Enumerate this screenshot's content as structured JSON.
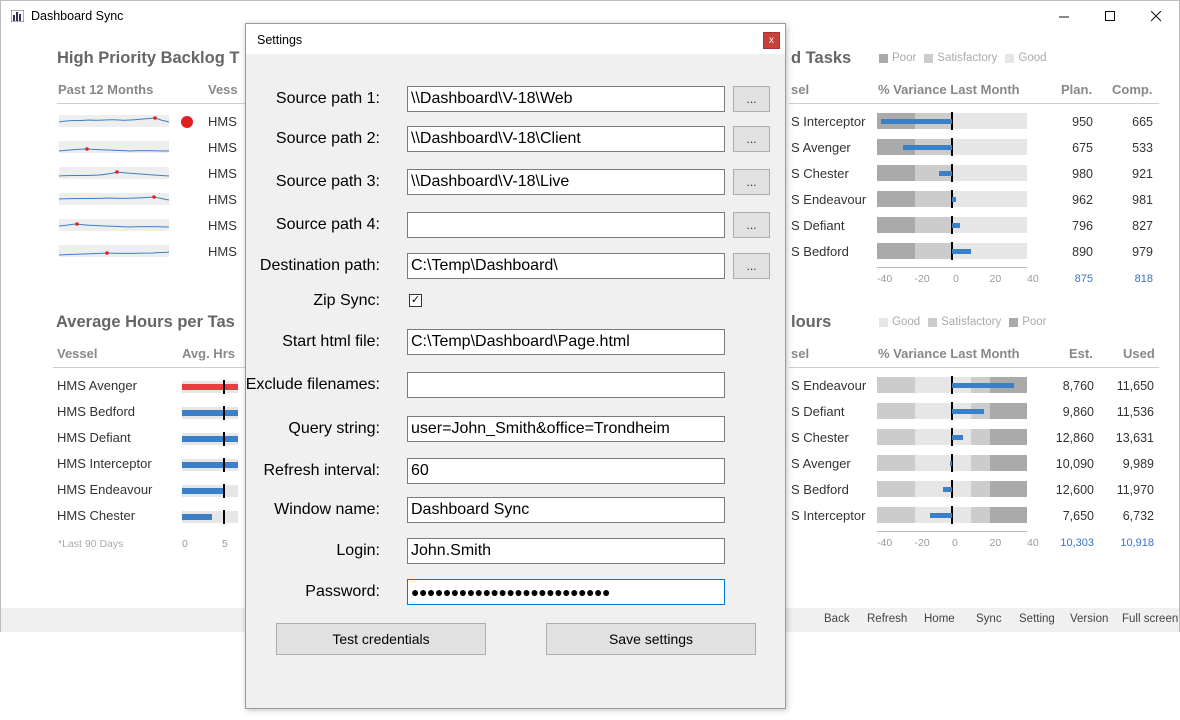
{
  "window": {
    "title": "Dashboard Sync",
    "controls": [
      "minimize",
      "maximize",
      "close"
    ]
  },
  "backlog": {
    "title": "High Priority Backlog T",
    "col_past": "Past 12 Months",
    "col_vessel": "Vess",
    "rows": [
      "HMS",
      "HMS",
      "HMS",
      "HMS",
      "HMS",
      "HMS"
    ],
    "alert_color": "#e02020"
  },
  "tasks": {
    "title": "d Tasks",
    "legend": [
      "Poor",
      "Satisfactory",
      "Good"
    ],
    "col_vessel": "sel",
    "col_variance": "% Variance Last Month",
    "col_plan": "Plan.",
    "col_comp": "Comp.",
    "rows": [
      {
        "vessel": "S Interceptor",
        "plan": "950",
        "comp": "665",
        "variance": -38
      },
      {
        "vessel": "S Avenger",
        "plan": "675",
        "comp": "533",
        "variance": -26
      },
      {
        "vessel": "S Chester",
        "plan": "980",
        "comp": "921",
        "variance": -7
      },
      {
        "vessel": "S Endeavour",
        "plan": "962",
        "comp": "981",
        "variance": 2
      },
      {
        "vessel": "S Defiant",
        "plan": "796",
        "comp": "827",
        "variance": 4
      },
      {
        "vessel": "S Bedford",
        "plan": "890",
        "comp": "979",
        "variance": 10
      }
    ],
    "ticks": [
      "-40",
      "-20",
      "0",
      "20",
      "40"
    ],
    "total_plan": "875",
    "total_comp": "818"
  },
  "avg_hours": {
    "title": "Average Hours per Tas",
    "col_vessel": "Vessel",
    "col_avg": "Avg. Hrs",
    "rows": [
      "HMS Avenger",
      "HMS Bedford",
      "HMS Defiant",
      "HMS Interceptor",
      "HMS Endeavour",
      "HMS Chester"
    ],
    "footnote": "*Last 90 Days",
    "ticks": [
      "0",
      "5"
    ]
  },
  "hours": {
    "title": "lours",
    "legend": [
      "Good",
      "Satisfactory",
      "Poor"
    ],
    "col_vessel": "sel",
    "col_variance": "% Variance Last Month",
    "col_est": "Est.",
    "col_used": "Used",
    "rows": [
      {
        "vessel": "S Endeavour",
        "est": "8,760",
        "used": "11,650",
        "variance": 33
      },
      {
        "vessel": "S Defiant",
        "est": "9,860",
        "used": "11,536",
        "variance": 17
      },
      {
        "vessel": "S Chester",
        "est": "12,860",
        "used": "13,631",
        "variance": 6
      },
      {
        "vessel": "S Avenger",
        "est": "10,090",
        "used": "9,989",
        "variance": -1
      },
      {
        "vessel": "S Bedford",
        "est": "12,600",
        "used": "11,970",
        "variance": -5
      },
      {
        "vessel": "S Interceptor",
        "est": "7,650",
        "used": "6,732",
        "variance": -12
      }
    ],
    "ticks": [
      "-40",
      "-20",
      "0",
      "20",
      "40"
    ],
    "total_est": "10,303",
    "total_used": "10,918"
  },
  "footer": [
    "Back",
    "Refresh",
    "Home",
    "Sync",
    "Setting",
    "Version",
    "Full screen"
  ],
  "dialog": {
    "title": "Settings",
    "close": "x",
    "fields": {
      "source1": {
        "label": "Source path 1:",
        "value": "\\\\Dashboard\\V-18\\Web"
      },
      "source2": {
        "label": "Source path 2:",
        "value": "\\\\Dashboard\\V-18\\Client"
      },
      "source3": {
        "label": "Source path 3:",
        "value": "\\\\Dashboard\\V-18\\Live"
      },
      "source4": {
        "label": "Source path 4:",
        "value": ""
      },
      "dest": {
        "label": "Destination path:",
        "value": "C:\\Temp\\Dashboard\\"
      },
      "zip": {
        "label": "Zip Sync:",
        "checked": true,
        "mark": "✓"
      },
      "start": {
        "label": "Start html file:",
        "value": "C:\\Temp\\Dashboard\\Page.html"
      },
      "exclude": {
        "label": "Exclude filenames:",
        "value": ""
      },
      "query": {
        "label": "Query string:",
        "value": "user=John_Smith&office=Trondheim"
      },
      "refresh": {
        "label": "Refresh interval:",
        "value": "60"
      },
      "winname": {
        "label": "Window name:",
        "value": "Dashboard Sync"
      },
      "login": {
        "label": "Login:",
        "value": "John.Smith"
      },
      "password": {
        "label": "Password:",
        "value": "●●●●●●●●●●●●●●●●●●●●●●●●●"
      }
    },
    "browse_label": "...",
    "test_button": "Test credentials",
    "save_button": "Save settings"
  }
}
